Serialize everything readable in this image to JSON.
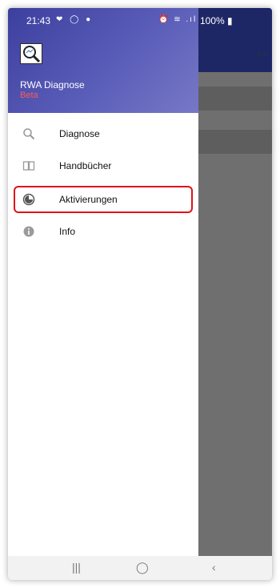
{
  "status_bar": {
    "time": "21:43",
    "left_icons": "❤ ◯ ●",
    "right_icons": "⏰ ≋ .ıl",
    "battery": "100%"
  },
  "drawer": {
    "app_name": "RWA Diagnose",
    "app_tag": "Beta",
    "items": [
      {
        "label": "Diagnose",
        "icon": "search-icon"
      },
      {
        "label": "Handbücher",
        "icon": "book-icon"
      },
      {
        "label": "Aktivierungen",
        "icon": "activation-icon"
      },
      {
        "label": "Info",
        "icon": "info-icon"
      }
    ]
  },
  "nav_bar": {
    "recents": "|||",
    "home": "◯",
    "back": "‹"
  },
  "colors": {
    "header_gradient_start": "#3c3f9e",
    "header_gradient_end": "#7778c6",
    "beta": "#ff5a5a",
    "highlight": "#e0121a",
    "app_bar": "#1e2766"
  }
}
